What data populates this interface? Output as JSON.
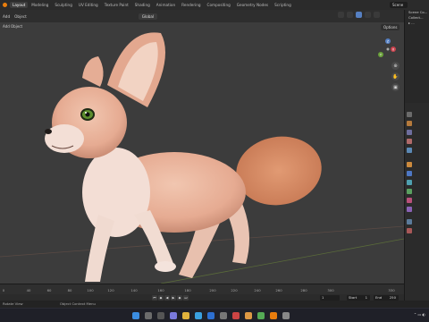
{
  "topbar": {
    "workspaces": [
      "Layout",
      "Modeling",
      "Sculpting",
      "UV Editing",
      "Texture Paint",
      "Shading",
      "Animation",
      "Rendering",
      "Compositing",
      "Geometry Nodes",
      "Scripting"
    ],
    "scene_label": "Scene"
  },
  "viewport_header": {
    "menus": [
      "Add",
      "Object"
    ],
    "transform": "Global",
    "sub_label": "Add  Object"
  },
  "viewport": {
    "options_label": "Options",
    "gizmo": {
      "x": "X",
      "y": "Y",
      "z": "Z"
    }
  },
  "outliner": {
    "rows": [
      "Scene Co...",
      "Collect...",
      "▸ ..."
    ]
  },
  "timeline": {
    "ticks": [
      "0",
      "40",
      "60",
      "80",
      "100",
      "120",
      "140",
      "160",
      "180",
      "200",
      "220",
      "240",
      "260",
      "280",
      "300",
      "330"
    ],
    "current_frame": "1",
    "start_label": "Start",
    "start_value": "1",
    "end_label": "End",
    "end_value": "250"
  },
  "statusbar": {
    "left": "Rotate View",
    "mid": "Object Context Menu"
  },
  "taskbar": {
    "time": ""
  },
  "colors": {
    "accent": "#e87d0d",
    "viewport_bg": "#3c3c3c",
    "fur": "#e9b49a"
  }
}
